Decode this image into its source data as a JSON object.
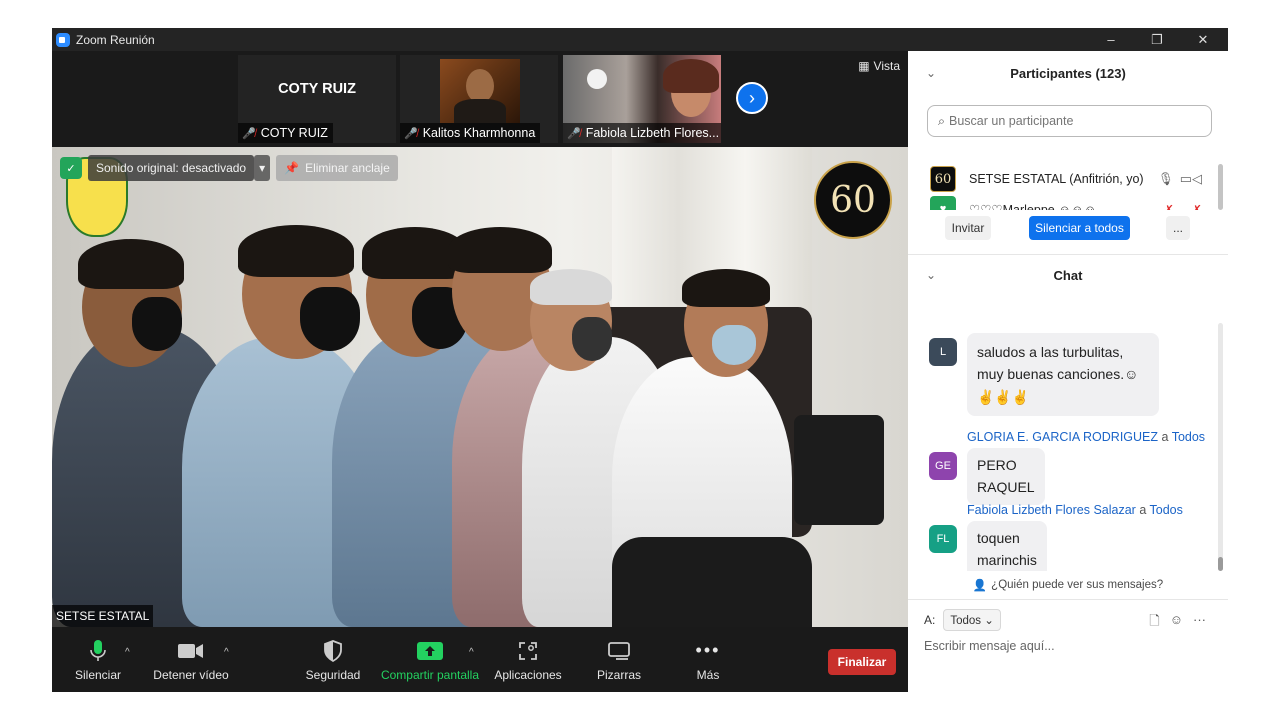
{
  "window": {
    "title": "Zoom Reunión",
    "controls": [
      "–",
      "❐",
      "✕"
    ]
  },
  "strip": {
    "view_label": "Vista",
    "thumbnails": [
      {
        "name": "COTY RUIZ",
        "big_name": "COTY RUIZ",
        "muted": true
      },
      {
        "name": "Kalitos Kharmhonna",
        "muted": true
      },
      {
        "name": "Fabiola Lizbeth Flores...",
        "muted": true
      }
    ]
  },
  "video": {
    "audio_pill": "Sonido original: desactivado",
    "unpin_pill": "Eliminar anclaje",
    "speaker_label": "SETSE ESTATAL",
    "logo_text": "60"
  },
  "toolbar": {
    "mute": "Silenciar",
    "stop_video": "Detener vídeo",
    "security": "Seguridad",
    "share": "Compartir pantalla",
    "apps": "Aplicaciones",
    "whiteboards": "Pizarras",
    "more": "Más",
    "end": "Finalizar"
  },
  "participants": {
    "header": "Participantes (123)",
    "search_placeholder": "Buscar un participante",
    "rows": [
      {
        "name": "SETSE ESTATAL (Anfitrión, yo)"
      },
      {
        "name": "♡♡♡Marleppe ☺☺☺"
      }
    ],
    "invite": "Invitar",
    "mute_all": "Silenciar a todos",
    "more": "..."
  },
  "chat": {
    "header": "Chat",
    "messages": [
      {
        "initials": "L",
        "text_line1": "saludos a las turbulitas,",
        "text_line2": "muy buenas canciones.☺",
        "text_line3": "✌✌✌",
        "color": "#3b4a5a"
      },
      {
        "initials": "GE",
        "sender": "GLORIA E. GARCIA RODRIGUEZ",
        "to_word": "a",
        "recipient": "Todos",
        "text": "PERO RAQUEL",
        "color": "#8e44ad"
      },
      {
        "initials": "FL",
        "sender": "Fabiola Lizbeth Flores Salazar",
        "to_word": "a",
        "recipient": "Todos",
        "text": "toquen marinchis toque",
        "color": "#16a085"
      }
    ],
    "who_can_see": "¿Quién puede ver sus mensajes?",
    "to_label": "A:",
    "to_value": "Todos",
    "input_placeholder": "Escribir mensaje aquí..."
  }
}
